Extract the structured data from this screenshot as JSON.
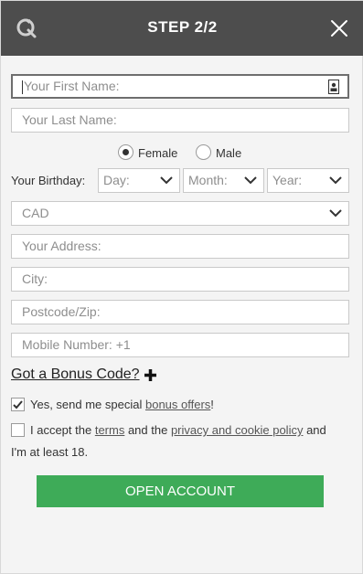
{
  "header": {
    "title": "STEP 2/2",
    "logo_icon": "refresh-q-logo",
    "close_icon": "close-icon"
  },
  "form": {
    "first_name_placeholder": "Your First Name:",
    "last_name_placeholder": "Your Last Name:",
    "gender": {
      "options": [
        "Female",
        "Male"
      ],
      "selected": "Female"
    },
    "birthday": {
      "label": "Your Birthday:",
      "day_placeholder": "Day:",
      "month_placeholder": "Month:",
      "year_placeholder": "Year:"
    },
    "currency_selected": "CAD",
    "address_placeholder": "Your Address:",
    "city_placeholder": "City:",
    "postcode_placeholder": "Postcode/Zip:",
    "mobile_placeholder": "Mobile Number: +1",
    "bonus_code_link": "Got a Bonus Code?",
    "bonus_offers": {
      "checked": true,
      "text_before": "Yes, send me special ",
      "link": "bonus offers",
      "text_after": "!"
    },
    "terms": {
      "checked": false,
      "text_1": "I accept the ",
      "terms_link": "terms",
      "text_2": " and the ",
      "privacy_link": "privacy and cookie policy",
      "text_3": " and",
      "text_4": "I'm at least 18."
    },
    "submit_label": "OPEN ACCOUNT"
  },
  "colors": {
    "header_bg": "#4d4d4d",
    "button_bg": "#3eab58",
    "panel_bg": "#f4f4f4"
  }
}
